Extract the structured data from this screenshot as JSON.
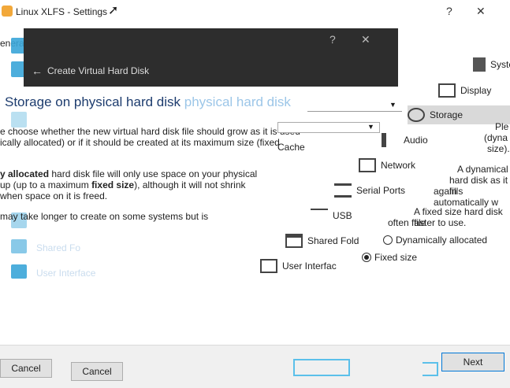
{
  "window": {
    "title": "Linux XLFS - Settings",
    "help": "?",
    "close": "✕"
  },
  "sidebar": {
    "general_tab": "eneral",
    "faint_items": [
      "Shared Fo",
      "User Interface"
    ]
  },
  "categories": [
    {
      "label": "System",
      "icon": "chip-icon"
    },
    {
      "label": "Display",
      "icon": "monitor-icon"
    },
    {
      "label": "Storage",
      "icon": "disk-icon"
    },
    {
      "label": "Audio",
      "icon": "speaker-icon"
    },
    {
      "label": "Network",
      "icon": "network-icon"
    },
    {
      "label": "Serial Ports",
      "icon": "serial-icon"
    },
    {
      "label": "USB",
      "icon": "usb-icon"
    },
    {
      "label": "Shared Fold",
      "icon": "folder-icon"
    },
    {
      "label": "User Interfac",
      "icon": "ui-icon"
    }
  ],
  "dialog": {
    "title": "Create Virtual Hard Disk",
    "heading": "Storage on physical hard disk",
    "heading_ghost": "physical hard disk",
    "intro": "e choose whether the new virtual hard disk file should grow as it is used",
    "intro2": "ically allocated) or if it should be created at its maximum size (fixed",
    "cache": "Cache",
    "dyn_title": "y allocated",
    "dyn_text": "hard disk file will only use space on your physical",
    "dyn_text2": "up (up to a maximum",
    "dyn_fixed": "fixed size",
    "dyn_text3": "), although it will not shrink",
    "dyn_text4": "when space on it is freed.",
    "fixed_text": "may take longer to create on some systems but is",
    "right_please": "Ple",
    "right_dyn": "(dyna",
    "right_size": "size).",
    "right_a_dyn": "A dynamical",
    "right_a_dyn2": "hard disk as it fills",
    "right_a_dyn3": "again automatically w",
    "right_a_fixed": "A fixed size hard disk file",
    "right_a_fixed2": "often faster to use.",
    "option_dynamic": "Dynamically allocated",
    "option_fixed": "Fixed size",
    "selected": "Fixed size"
  },
  "footer": {
    "cancel_left": "Cancel",
    "cancel_mid": "Cancel",
    "next": "Next"
  }
}
